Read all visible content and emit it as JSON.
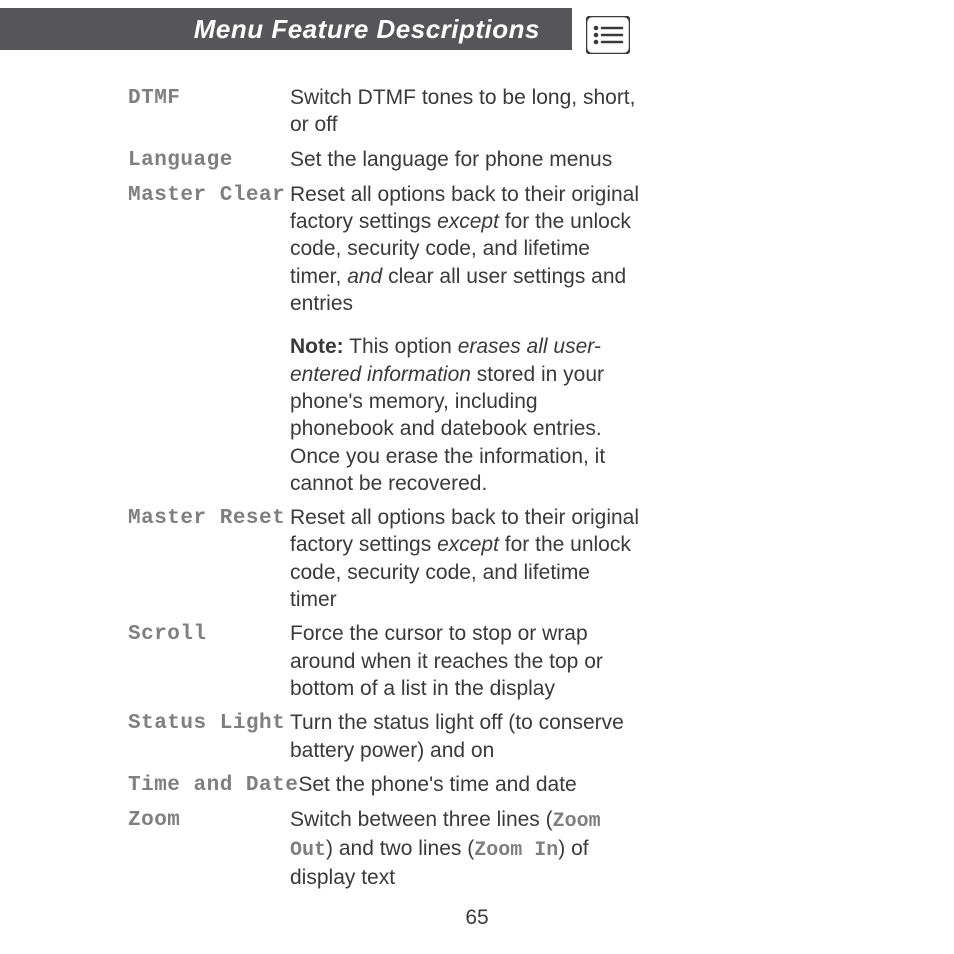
{
  "header": {
    "title": "Menu Feature Descriptions"
  },
  "rows": {
    "dtmf": {
      "term": "DTMF",
      "desc_a": "Switch DTMF tones to be long, short, or off"
    },
    "language": {
      "term": "Language",
      "desc_a": "Set the language for phone menus"
    },
    "masterclear": {
      "term": "Master Clear",
      "desc_a": "Reset all options back to their original factory settings ",
      "desc_b": "except",
      "desc_c": " for the unlock code, security code, and lifetime timer, ",
      "desc_d": "and",
      "desc_e": " clear all user settings and entries",
      "note_a": "Note:",
      "note_b": " This option ",
      "note_c": "erases all user-entered information",
      "note_d": " stored in your phone's memory, including phonebook and datebook entries. Once you erase the information, it cannot be recovered."
    },
    "masterreset": {
      "term": "Master Reset",
      "desc_a": "Reset all options back to their original factory settings ",
      "desc_b": "except",
      "desc_c": " for the unlock code, security code, and lifetime timer"
    },
    "scroll": {
      "term": "Scroll",
      "desc_a": "Force the cursor to stop or wrap around when it reaches the top or bottom of a list in the display"
    },
    "statuslight": {
      "term": "Status Light",
      "desc_a": "Turn the status light off (to conserve battery power) and on"
    },
    "timedate": {
      "term": "Time and Date",
      "desc_a": "Set the phone's time and date"
    },
    "zoom": {
      "term": "Zoom",
      "desc_a": "Switch between three lines (",
      "desc_b": "Zoom Out",
      "desc_c": ") and two lines (",
      "desc_d": "Zoom In",
      "desc_e": ") of display text"
    }
  },
  "page_number": "65"
}
